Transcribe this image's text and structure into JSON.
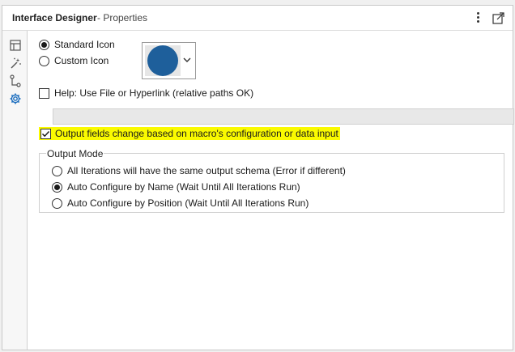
{
  "titlebar": {
    "title": "Interface Designer",
    "subtitle": "- Properties",
    "menu_icon": "kebab-menu-icon",
    "undock_icon": "undock-icon"
  },
  "sidebar": {
    "items": [
      {
        "icon": "layout-icon"
      },
      {
        "icon": "magic-wand-icon"
      },
      {
        "icon": "tree-icon"
      },
      {
        "icon": "gear-icon",
        "active": true
      }
    ]
  },
  "icon_options": {
    "standard_label": "Standard Icon",
    "custom_label": "Custom Icon",
    "selected": "standard",
    "icon_color": "#1e5f9b"
  },
  "help": {
    "label": "Help: Use File or Hyperlink (relative paths OK)",
    "checked": false,
    "value": ""
  },
  "output_fields": {
    "label": "Output fields change based on macro's configuration or data input",
    "checked": true,
    "highlight_color": "#fafa00"
  },
  "output_mode": {
    "legend": "Output Mode",
    "options": [
      {
        "label": "All Iterations will have the same output schema (Error if different)",
        "checked": false
      },
      {
        "label": "Auto Configure by Name (Wait Until All Iterations Run)",
        "checked": true
      },
      {
        "label": "Auto Configure by Position (Wait Until All Iterations Run)",
        "checked": false
      }
    ]
  }
}
